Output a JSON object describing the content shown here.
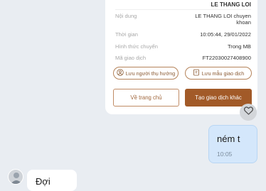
{
  "receipt": {
    "recipient_name": "LE THANG LOI",
    "rows": [
      {
        "label": "Nội dung",
        "value_line1": "LE THANG LOI chuyen",
        "value_line2": "khoan"
      },
      {
        "label": "Thời gian",
        "value": "10:05:44, 29/01/2022"
      },
      {
        "label": "Hình thức chuyển",
        "value": "Trong MB"
      },
      {
        "label": "Mã giao dịch",
        "value": "FT22030027408900"
      }
    ],
    "save_recipient_label": "Lưu người thụ hưởng",
    "save_template_label": "Lưu mẫu giao dịch",
    "home_label": "Về trang chủ",
    "new_transaction_label": "Tạo giao dịch khác"
  },
  "outgoing_message": {
    "text": "ném t",
    "time": "10:05"
  },
  "incoming_message": {
    "text": "Đợi"
  },
  "colors": {
    "accent": "#a25a28",
    "outgoing_bubble": "#d4e7fb",
    "background": "#e9edf2"
  },
  "icons": [
    "user-circle-icon",
    "bookmark-icon",
    "heart-icon",
    "avatar"
  ]
}
